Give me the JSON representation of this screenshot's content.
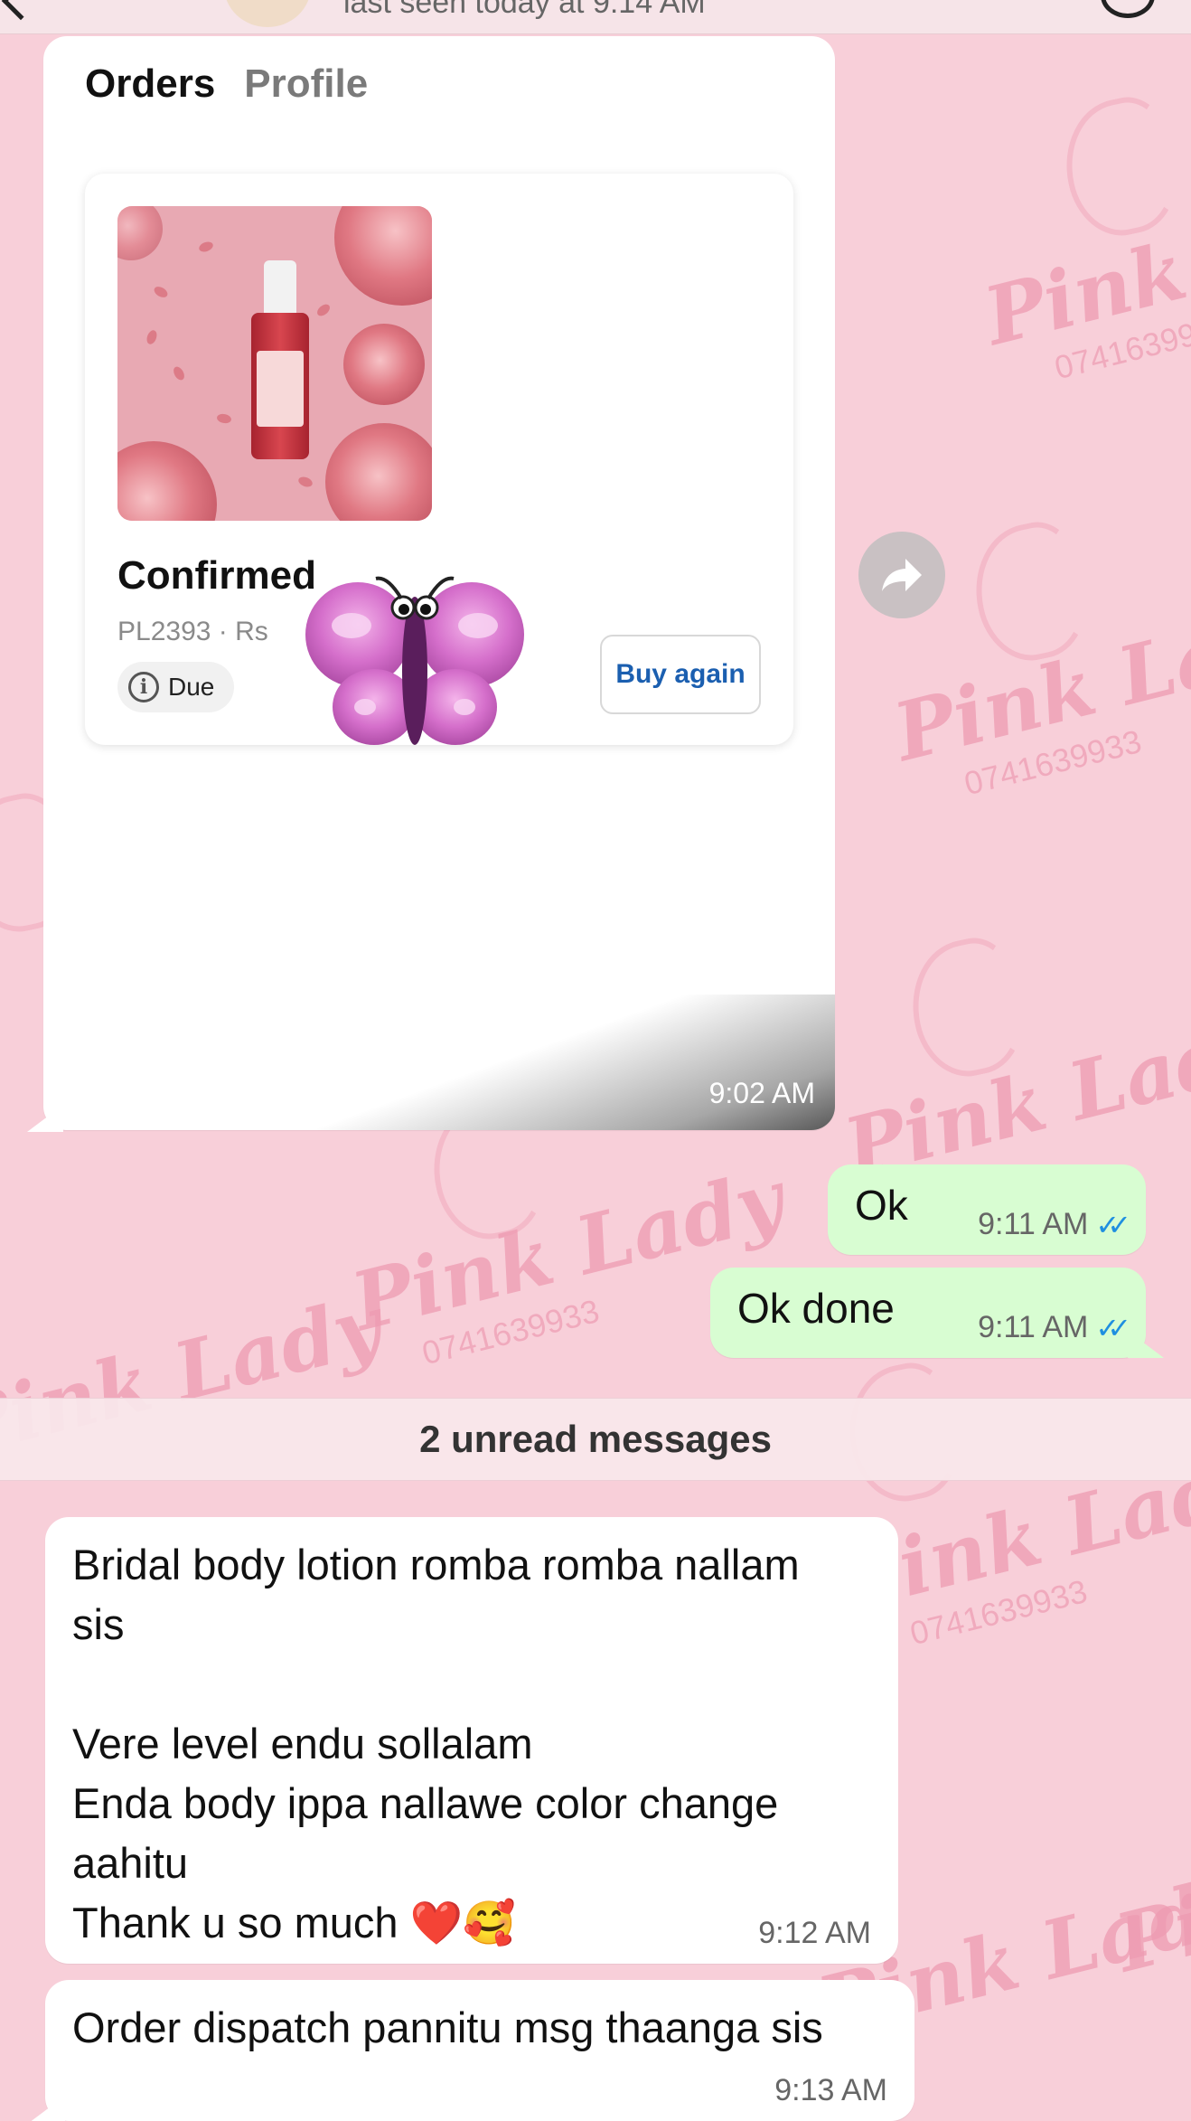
{
  "header": {
    "status_text": "last seen today at 9:14 AM"
  },
  "wallpaper": {
    "brand": "Pink Lady",
    "phone": "0741639933"
  },
  "order_message": {
    "tabs": [
      {
        "label": "Orders",
        "active": true
      },
      {
        "label": "Profile",
        "active": false
      }
    ],
    "order": {
      "status": "Confirmed",
      "meta": "PL2393 · Rs",
      "payment_chip": "Due",
      "action_label": "Buy again"
    },
    "time": "9:02 AM"
  },
  "outgoing": [
    {
      "text": "Ok",
      "time": "9:11 AM",
      "ticks": "✓✓"
    },
    {
      "text": "Ok done",
      "time": "9:11 AM",
      "ticks": "✓✓"
    }
  ],
  "unread_divider": "2 unread messages",
  "incoming": [
    {
      "text": "Bridal body lotion romba romba nallam\nsis\n\nVere level endu sollalam\nEnda body ippa nallawe color change\naahitu\nThank u so much ❤️🥰",
      "time": "9:12 AM"
    },
    {
      "text": "Order dispatch pannitu msg thaanga sis",
      "time": "9:13 AM"
    }
  ],
  "colors": {
    "wallpaper": "#f8cfd9",
    "outgoing_bubble": "#d8fdd2",
    "read_ticks": "#1f8fe0",
    "buy_again_text": "#1b5fb0"
  }
}
